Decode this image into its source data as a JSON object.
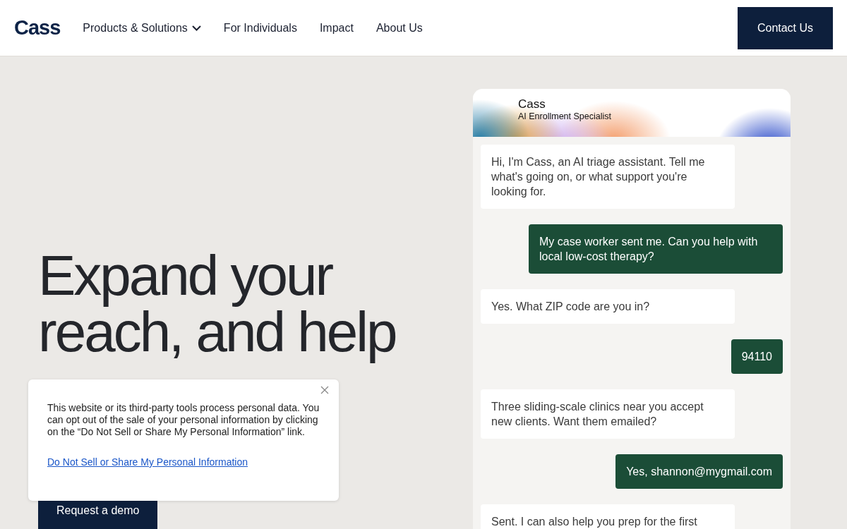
{
  "header": {
    "logo": "Cass",
    "nav": [
      {
        "label": "Products & Solutions",
        "dropdown": true
      },
      {
        "label": "For Individuals",
        "dropdown": false
      },
      {
        "label": "Impact",
        "dropdown": false
      },
      {
        "label": "About Us",
        "dropdown": false
      }
    ],
    "cta": "Contact Us"
  },
  "hero": {
    "headline": [
      "Expand your",
      "reach, and help"
    ],
    "button": "Request a demo"
  },
  "chat": {
    "name": "Cass",
    "role": "AI Enrollment Specialist",
    "messages": [
      {
        "kind": "bot",
        "text": "Hi, I'm Cass, an AI triage assistant. Tell me what's going on, or what support you're looking for."
      },
      {
        "kind": "user",
        "text": "My case worker sent me. Can you help with local low-cost therapy?"
      },
      {
        "kind": "bot",
        "text": "Yes. What ZIP code are you in?"
      },
      {
        "kind": "user",
        "text": "94110"
      },
      {
        "kind": "bot",
        "text": "Three sliding-scale clinics near you accept new clients. Want them emailed?"
      },
      {
        "kind": "user",
        "text": "Yes, shannon@mygmail.com"
      },
      {
        "kind": "bot",
        "text": "Sent. I can also help you prep for the first"
      }
    ]
  },
  "cookie_notice": {
    "text": "This website or its third-party tools process personal data. You can opt out of the sale of your personal information by clicking on the “Do Not Sell or Share My Personal Information” link.",
    "link": "Do Not Sell or Share My Personal Information"
  }
}
